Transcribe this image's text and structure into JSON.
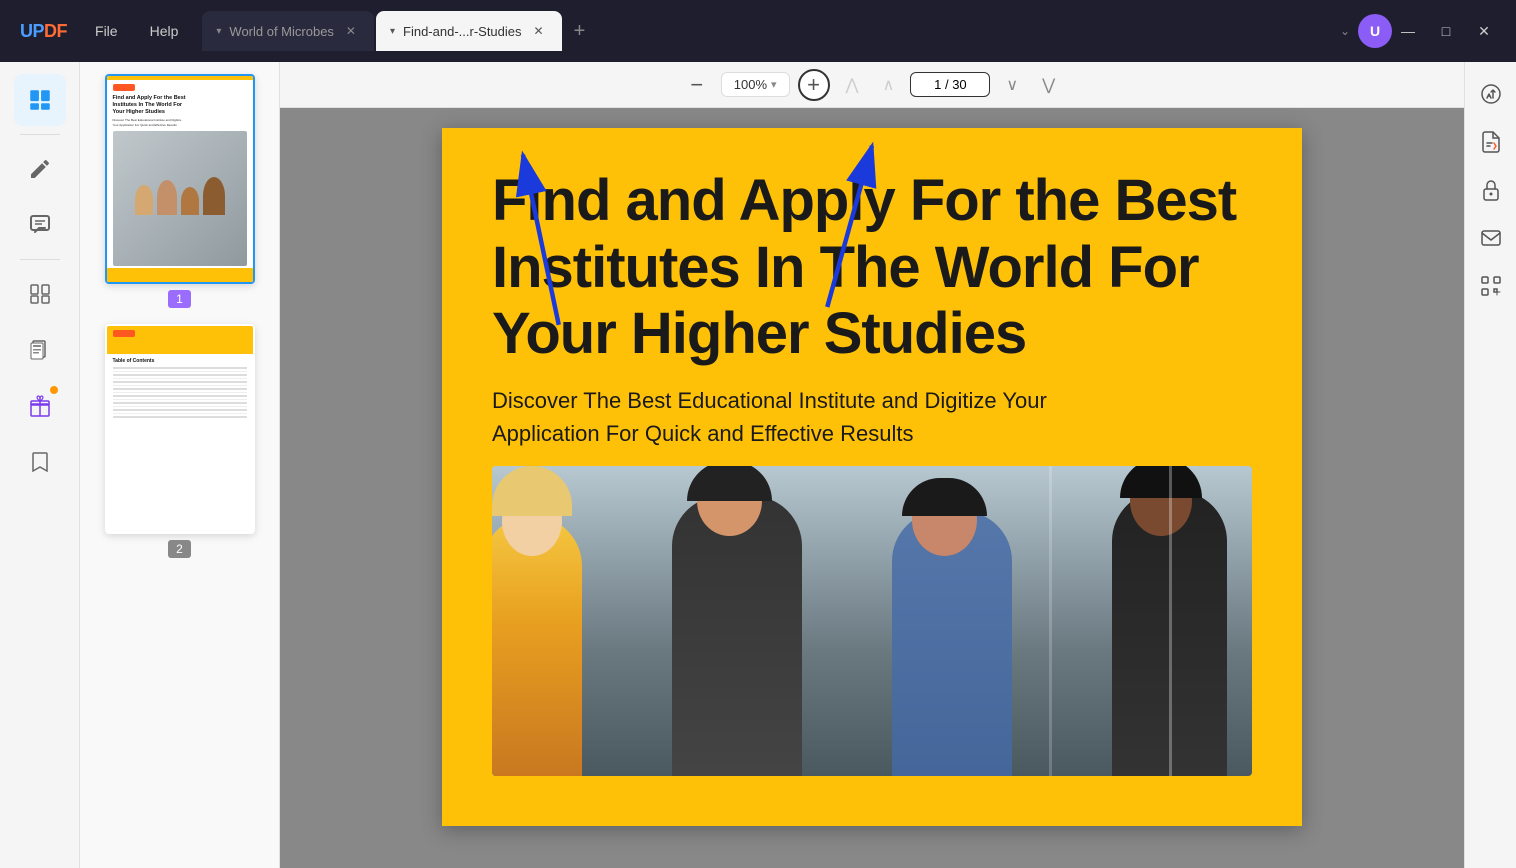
{
  "app": {
    "name": "UPDF",
    "logo_text": "UPDF"
  },
  "menu": {
    "file_label": "File",
    "help_label": "Help"
  },
  "tabs": [
    {
      "id": "tab1",
      "label": "World of Microbes",
      "active": false
    },
    {
      "id": "tab2",
      "label": "Find-and-...r-Studies",
      "active": true
    }
  ],
  "tab_add_label": "+",
  "window_controls": {
    "minimize": "—",
    "maximize": "□",
    "close": "✕"
  },
  "account": {
    "initial": "U"
  },
  "toolbar": {
    "zoom_out_label": "−",
    "zoom_in_label": "+",
    "zoom_level": "100%",
    "zoom_dropdown": "▾",
    "nav_first": "⌃",
    "nav_prev": "∧",
    "nav_next": "∨",
    "nav_last": "⌄",
    "page_current": "1",
    "page_total": "30",
    "page_separator": "/"
  },
  "sidebar": {
    "icons": [
      {
        "name": "reader-icon",
        "label": "Reader",
        "active": true
      },
      {
        "name": "edit-icon",
        "label": "Edit",
        "active": false
      },
      {
        "name": "comment-icon",
        "label": "Comment",
        "active": false
      },
      {
        "name": "organize-icon",
        "label": "Organize",
        "active": false
      },
      {
        "name": "pages-icon",
        "label": "Pages",
        "active": false
      },
      {
        "name": "gift-icon",
        "label": "Gift",
        "active": false,
        "has_badge": true
      },
      {
        "name": "bookmark-icon",
        "label": "Bookmark",
        "active": false
      }
    ]
  },
  "pdf": {
    "page1": {
      "main_title": "Find and Apply For the Best Institutes In The World For Your Higher Studies",
      "subtitle": "Discover The Best Educational Institute and Digitize Your Application For Quick and Effective Results"
    }
  },
  "thumbnails": [
    {
      "id": 1,
      "page_number": "1",
      "selected": true
    },
    {
      "id": 2,
      "page_number": "2",
      "selected": false
    }
  ],
  "right_sidebar": {
    "icons": [
      {
        "name": "ai-icon",
        "label": "AI"
      },
      {
        "name": "pdf-icon",
        "label": "PDF"
      },
      {
        "name": "lock-icon",
        "label": "Lock"
      },
      {
        "name": "email-icon",
        "label": "Email"
      },
      {
        "name": "ocr-icon",
        "label": "OCR"
      }
    ]
  },
  "colors": {
    "tab_inactive_bg": "#2a2a3e",
    "tab_active_bg": "#f5f5f5",
    "accent_blue": "#2196f3",
    "accent_purple": "#8b5cf6",
    "pdf_bg": "#ffc107",
    "arrow_color": "#1a3adb"
  }
}
